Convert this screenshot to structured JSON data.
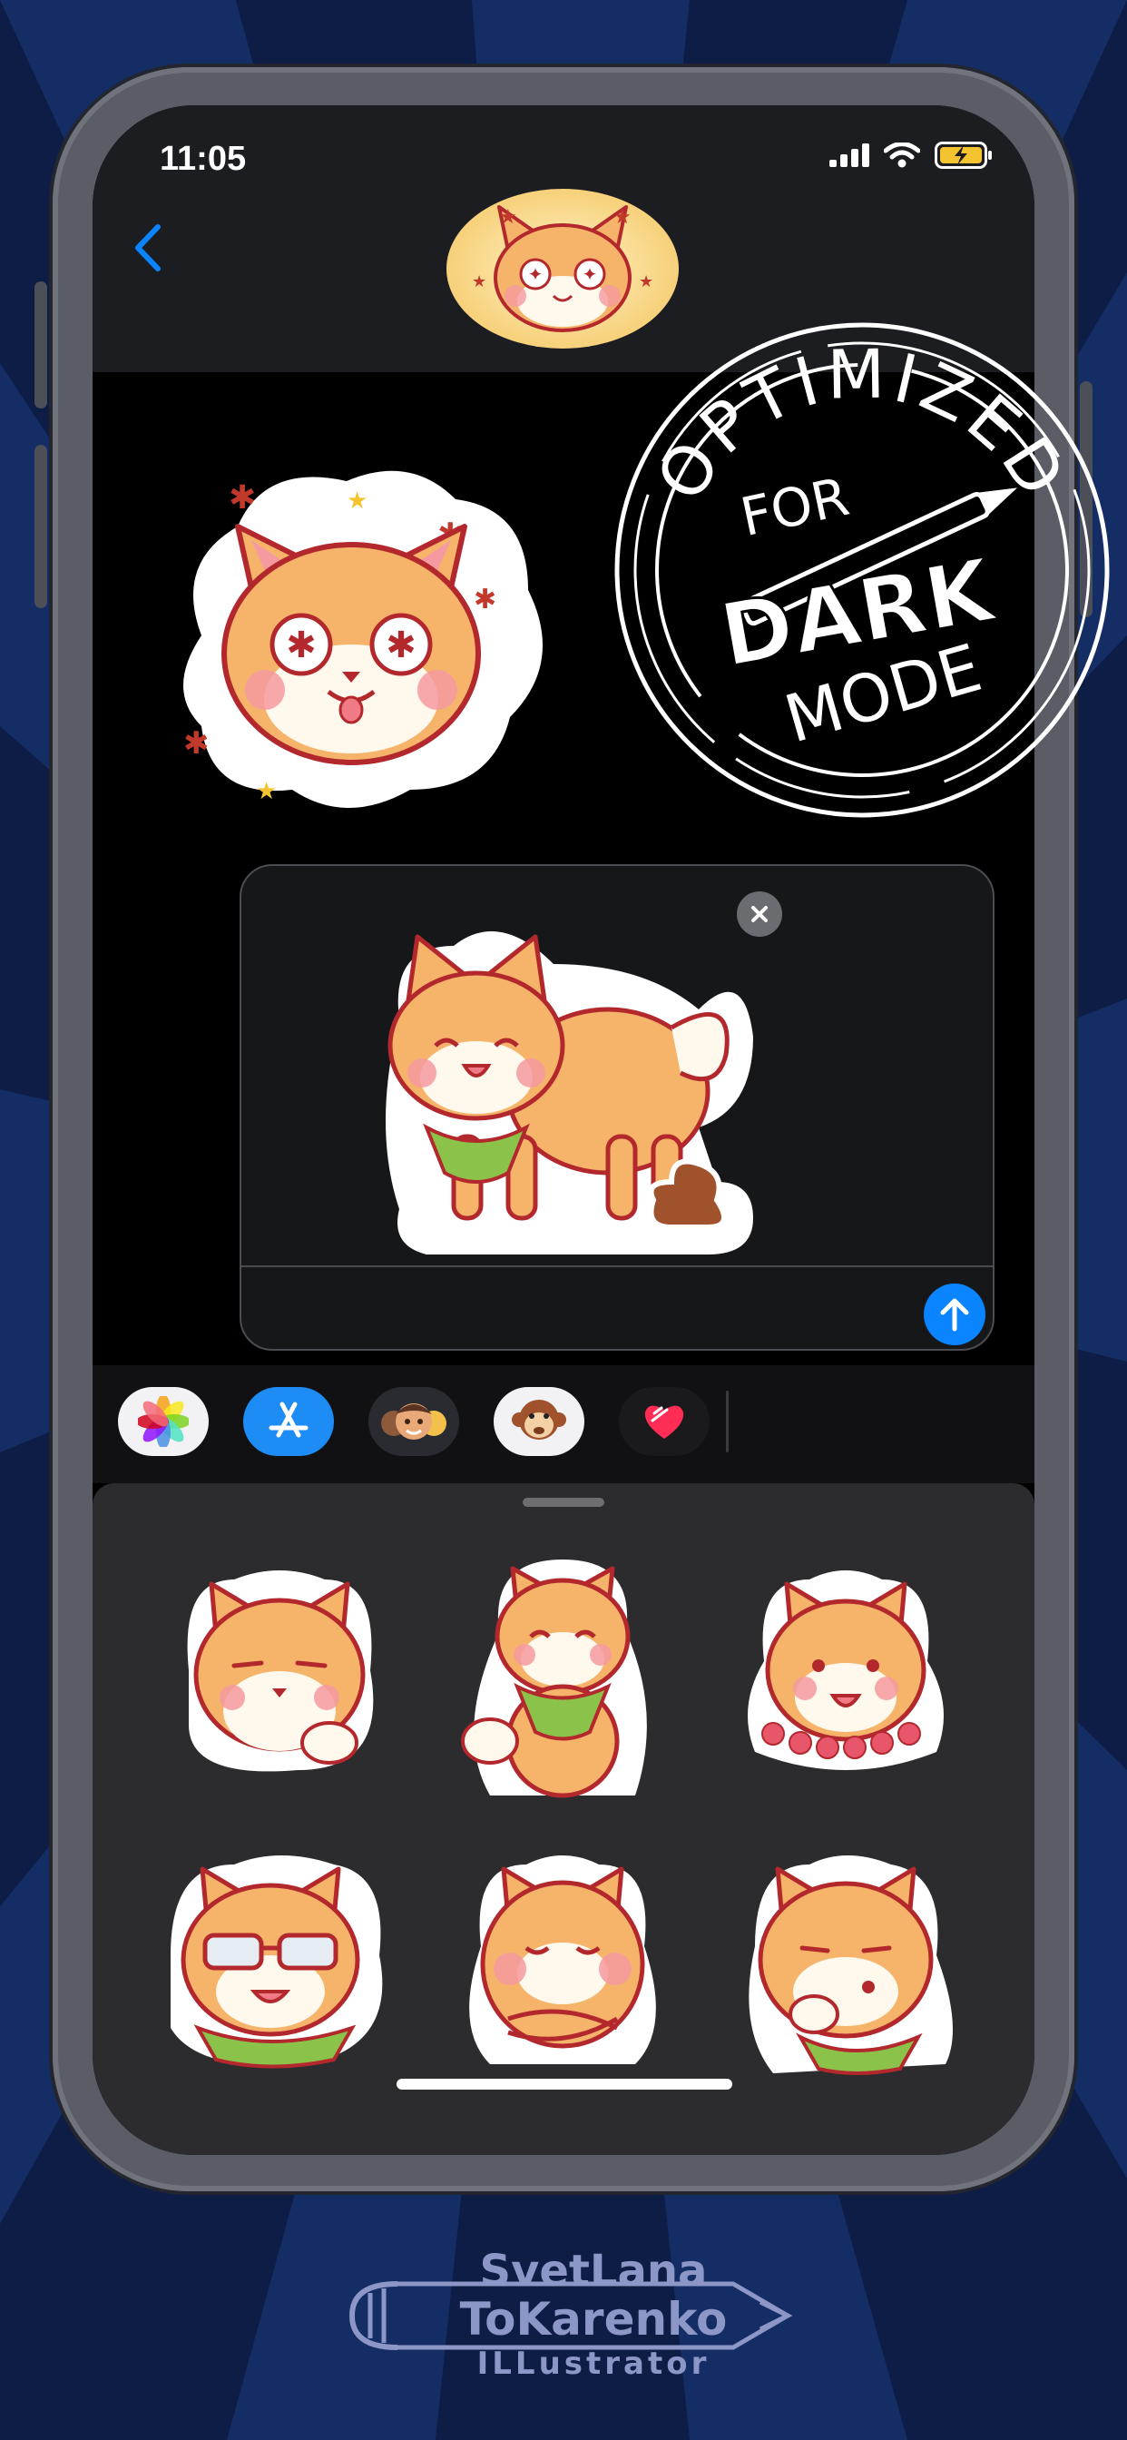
{
  "status_bar": {
    "time": "11:05"
  },
  "badge": {
    "line1": "OPTIMIZED",
    "line2": "FOR",
    "line3": "DARK",
    "line4": "MODE"
  },
  "signature": {
    "line1": "SvetLana",
    "line2": "ToKarenko",
    "line3": "ILLustrator"
  },
  "app_tray": {
    "items": [
      {
        "name": "photos-app",
        "icon": "photos-icon"
      },
      {
        "name": "app-store",
        "icon": "app-store-icon"
      },
      {
        "name": "memoji-stickers",
        "icon": "memoji-icon"
      },
      {
        "name": "animoji",
        "icon": "monkey-icon"
      },
      {
        "name": "digital-touch",
        "icon": "heart-icon"
      }
    ]
  },
  "stickers": [
    "shiba-thinking",
    "shiba-scarf-sitting",
    "shiba-flower-lei",
    "shiba-sunglasses",
    "shiba-arms-crossed",
    "shiba-pondering"
  ],
  "colors": {
    "background": "#0d1d45",
    "accent": "#0a84ff",
    "shiba_orange": "#f6b46a",
    "outline": "#b3282d"
  }
}
